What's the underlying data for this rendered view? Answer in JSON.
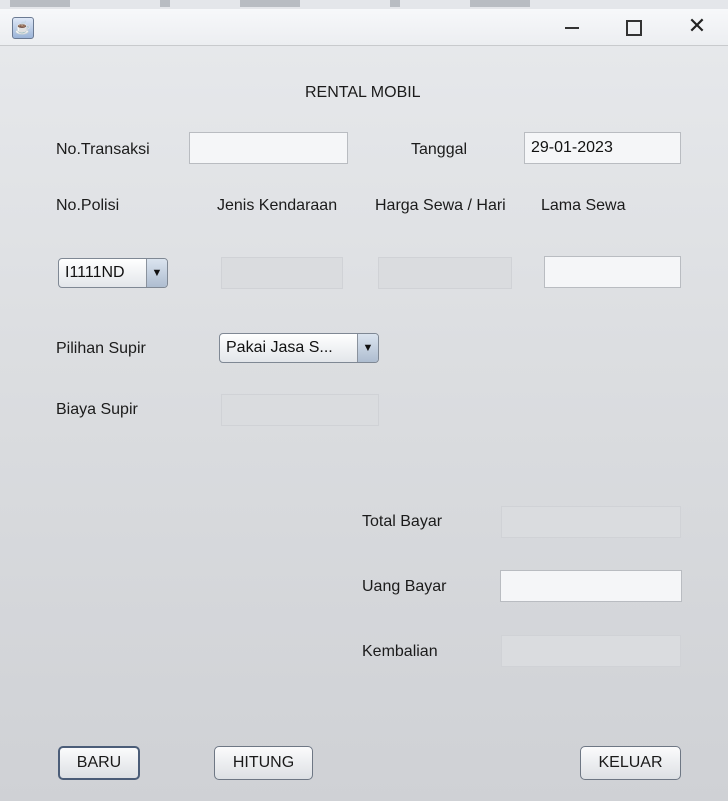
{
  "window": {
    "title_icon": "java-cup-icon",
    "minimize_icon": "minimize-icon",
    "maximize_icon": "maximize-icon",
    "close_icon": "close-icon",
    "close_glyph": "✕"
  },
  "form": {
    "title": "RENTAL MOBIL",
    "no_transaksi_label": "No.Transaksi",
    "no_transaksi_value": "",
    "tanggal_label": "Tanggal",
    "tanggal_value": "29-01-2023",
    "no_polisi_label": "No.Polisi",
    "jenis_kendaraan_label": "Jenis Kendaraan",
    "harga_sewa_label": "Harga Sewa / Hari",
    "lama_sewa_label": "Lama Sewa",
    "no_polisi_selected": "I1111ND",
    "jenis_kendaraan_value": "",
    "harga_sewa_value": "",
    "lama_sewa_value": "",
    "pilihan_supir_label": "Pilihan Supir",
    "pilihan_supir_selected": "Pakai Jasa S...",
    "biaya_supir_label": "Biaya Supir",
    "biaya_supir_value": "",
    "total_bayar_label": "Total Bayar",
    "total_bayar_value": "",
    "uang_bayar_label": "Uang Bayar",
    "uang_bayar_value": "",
    "kembalian_label": "Kembalian",
    "kembalian_value": "",
    "dropdown_arrow": "▼"
  },
  "buttons": {
    "baru": "BARU",
    "hitung": "HITUNG",
    "keluar": "KELUAR"
  }
}
